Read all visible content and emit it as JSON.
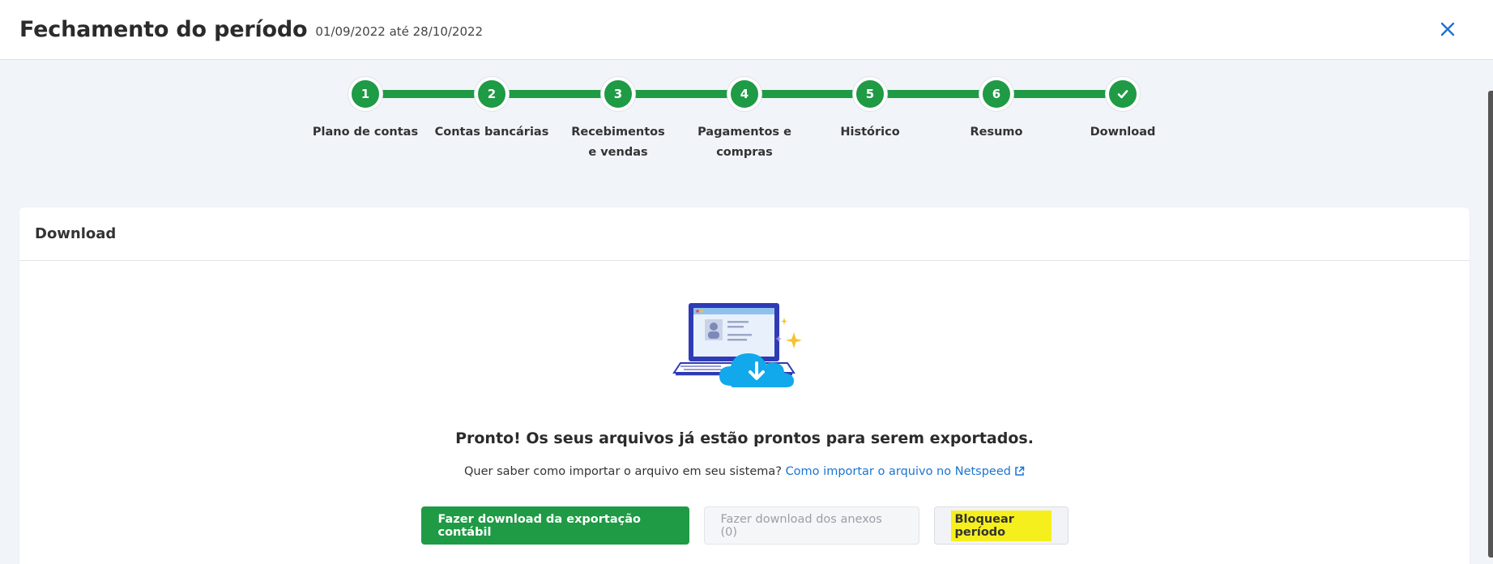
{
  "header": {
    "title": "Fechamento do período",
    "date_range": "01/09/2022 até 28/10/2022",
    "close_icon": "close-icon"
  },
  "colors": {
    "primary_green": "#1f9a45",
    "link_blue": "#1b74d1",
    "highlight_yellow": "#f6ef1e"
  },
  "stepper": {
    "steps": [
      {
        "number": "1",
        "label": "Plano de contas"
      },
      {
        "number": "2",
        "label": "Contas bancárias"
      },
      {
        "number": "3",
        "label": "Recebimentos e vendas"
      },
      {
        "number": "4",
        "label": "Pagamentos e compras"
      },
      {
        "number": "5",
        "label": "Histórico"
      },
      {
        "number": "6",
        "label": "Resumo"
      },
      {
        "number": "",
        "label": "Download",
        "icon": "check-icon"
      }
    ]
  },
  "card": {
    "title": "Download",
    "illustration_icon": "laptop-cloud-download-icon",
    "ready_message": "Pronto! Os seus arquivos já estão prontos para serem exportados.",
    "help_text": "Quer saber como importar o arquivo em seu sistema?",
    "help_link": "Como importar o arquivo no Netspeed",
    "buttons": {
      "download_export": "Fazer download da exportação contábil",
      "download_attachments": "Fazer download dos anexos (0)",
      "lock_period": "Bloquear período"
    }
  }
}
